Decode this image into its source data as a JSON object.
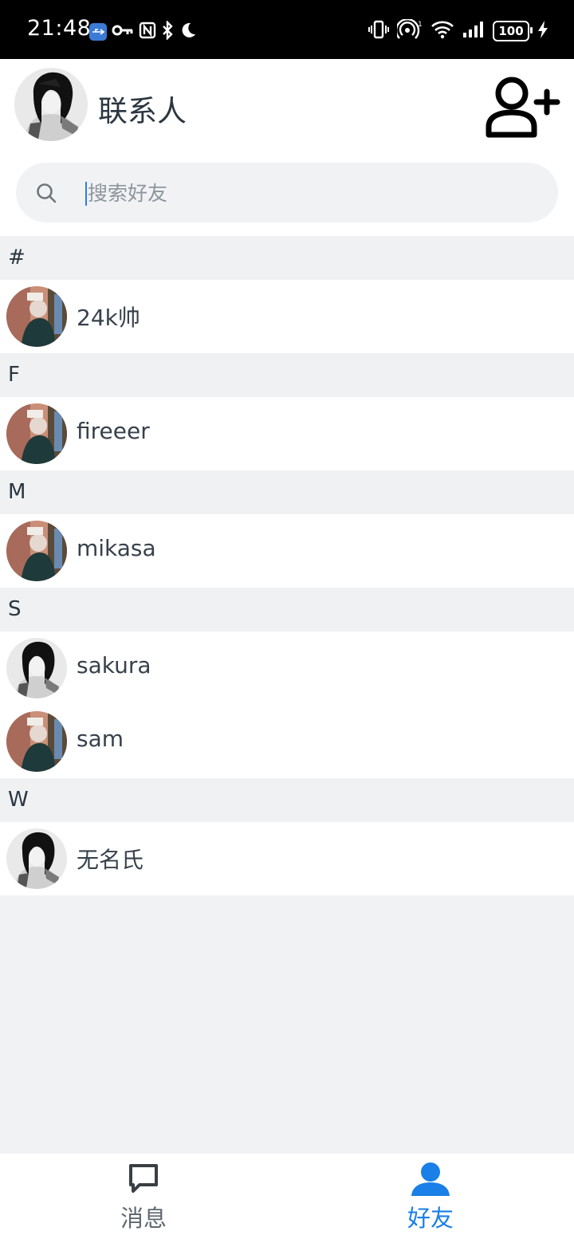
{
  "status_bar": {
    "time": "21:48",
    "battery": "100",
    "left_icons": [
      "usb-icon",
      "key-icon",
      "nfc-icon",
      "bluetooth-icon",
      "moon-icon"
    ],
    "right_icons": [
      "vibrate-icon",
      "hotspot-icon",
      "wifi-icon",
      "signal-icon",
      "battery-icon",
      "charging-icon"
    ]
  },
  "header": {
    "title": "联系人",
    "add_icon": "add-contact-icon"
  },
  "search": {
    "placeholder": "搜索好友",
    "value": ""
  },
  "sections": [
    {
      "letter": "#",
      "contacts": [
        {
          "name": "24k帅",
          "avatar": "avatar-color"
        }
      ]
    },
    {
      "letter": "F",
      "contacts": [
        {
          "name": "fireeer",
          "avatar": "avatar-color"
        }
      ]
    },
    {
      "letter": "M",
      "contacts": [
        {
          "name": "mikasa",
          "avatar": "avatar-color"
        }
      ]
    },
    {
      "letter": "S",
      "contacts": [
        {
          "name": "sakura",
          "avatar": "avatar-manga"
        },
        {
          "name": "sam",
          "avatar": "avatar-color"
        }
      ]
    },
    {
      "letter": "W",
      "contacts": [
        {
          "name": "无名氏",
          "avatar": "avatar-manga"
        }
      ]
    }
  ],
  "bottom_nav": {
    "messages_label": "消息",
    "friends_label": "好友",
    "active": "friends",
    "active_color": "#1a7fe6",
    "inactive_color": "#5f676f"
  }
}
